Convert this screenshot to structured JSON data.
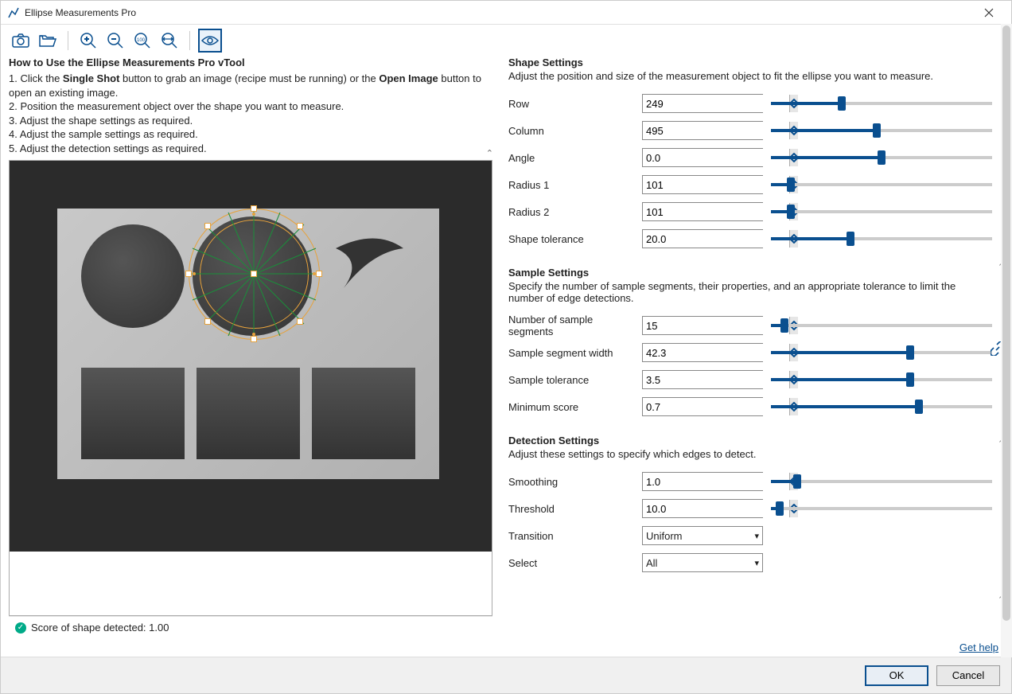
{
  "window": {
    "title": "Ellipse Measurements Pro"
  },
  "howto": {
    "heading": "How to Use the Ellipse Measurements Pro vTool",
    "step1a": "1. Click the ",
    "step1b": "Single Shot",
    "step1c": " button to grab an image (recipe must be running) or the ",
    "step1d": "Open Image",
    "step1e": " button to open an existing image.",
    "step2": "2. Position the measurement object over the shape you want to measure.",
    "step3": "3. Adjust the shape settings as required.",
    "step4": "4. Adjust the sample settings as required.",
    "step5": "5. Adjust the detection settings as required."
  },
  "status": {
    "text": "Score of shape detected: 1.00"
  },
  "sections": {
    "shape": {
      "title": "Shape Settings",
      "desc": "Adjust the position and size of the measurement object to fit the ellipse you want to measure.",
      "params": {
        "row": {
          "label": "Row",
          "value": "249",
          "pct": 32
        },
        "column": {
          "label": "Column",
          "value": "495",
          "pct": 48
        },
        "angle": {
          "label": "Angle",
          "value": "0.0",
          "pct": 50
        },
        "radius1": {
          "label": "Radius 1",
          "value": "101",
          "pct": 9
        },
        "radius2": {
          "label": "Radius 2",
          "value": "101",
          "pct": 9
        },
        "tol": {
          "label": "Shape tolerance",
          "value": "20.0",
          "pct": 36
        }
      }
    },
    "sample": {
      "title": "Sample Settings",
      "desc": "Specify the number of sample segments, their properties, and an appropriate tolerance to limit the number of edge detections.",
      "params": {
        "nseg": {
          "label": "Number of sample segments",
          "value": "15",
          "pct": 6
        },
        "swidth": {
          "label": "Sample segment width",
          "value": "42.3",
          "pct": 63
        },
        "stol": {
          "label": "Sample tolerance",
          "value": "3.5",
          "pct": 63
        },
        "mscore": {
          "label": "Minimum score",
          "value": "0.7",
          "pct": 67
        }
      }
    },
    "detect": {
      "title": "Detection Settings",
      "desc": "Adjust these settings to specify which edges to detect.",
      "params": {
        "smooth": {
          "label": "Smoothing",
          "value": "1.0",
          "pct": 12
        },
        "thresh": {
          "label": "Threshold",
          "value": "10.0",
          "pct": 4
        }
      },
      "combos": {
        "transition": {
          "label": "Transition",
          "value": "Uniform"
        },
        "select": {
          "label": "Select",
          "value": "All"
        }
      }
    }
  },
  "footer": {
    "help": "Get help",
    "ok": "OK",
    "cancel": "Cancel"
  }
}
